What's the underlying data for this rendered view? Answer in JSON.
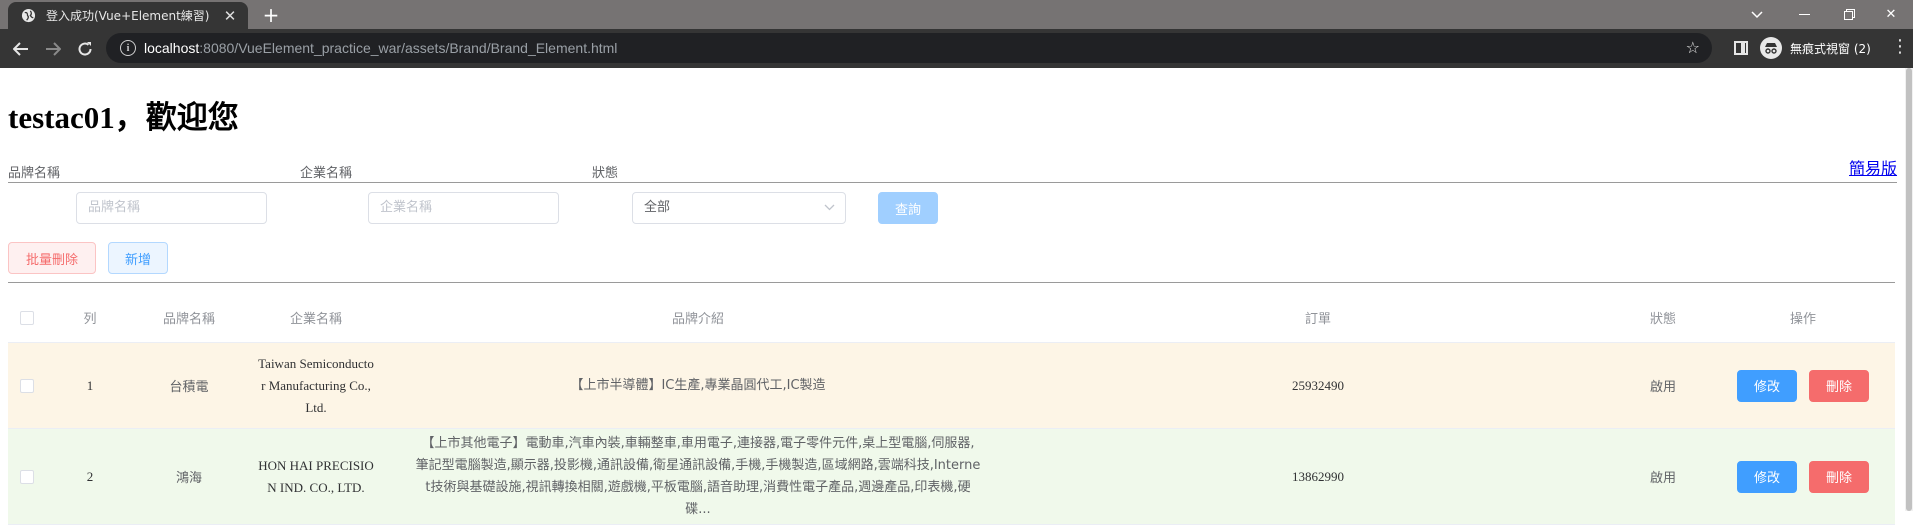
{
  "browser": {
    "tab_title": "登入成功(Vue+Element練習)",
    "url_host": "localhost",
    "url_rest": ":8080/VueElement_practice_war/assets/Brand/Brand_Element.html",
    "incognito_label": "無痕式視窗 (2)"
  },
  "page": {
    "welcome": "testac01，歡迎您",
    "simple_link": "簡易版"
  },
  "search": {
    "brand_label": "品牌名稱",
    "brand_placeholder": "品牌名稱",
    "company_label": "企業名稱",
    "company_placeholder": "企業名稱",
    "status_label": "狀態",
    "status_value": "全部",
    "query_button": "查詢"
  },
  "actions": {
    "batch_delete": "批量刪除",
    "add": "新增"
  },
  "table": {
    "headers": {
      "index": "列",
      "brand": "品牌名稱",
      "company": "企業名稱",
      "description": "品牌介紹",
      "order": "訂單",
      "status": "狀態",
      "operation": "操作"
    },
    "rows": [
      {
        "index": "1",
        "brand": "台積電",
        "company_lines": [
          "Taiwan Semiconducto",
          "r Manufacturing Co.,",
          "Ltd."
        ],
        "description_lines": [
          "【上市半導體】IC生產,專業晶圓代工,IC製造"
        ],
        "order": "25932490",
        "status": "啟用",
        "edit": "修改",
        "delete": "刪除"
      },
      {
        "index": "2",
        "brand": "鴻海",
        "company_lines": [
          "HON HAI PRECISIO",
          "N IND. CO., LTD."
        ],
        "description_lines": [
          "【上市其他電子】電動車,汽車內裝,車輛整車,車用電子,連接器,電子零件元件,桌上型電腦,伺服器,",
          "筆記型電腦製造,顯示器,投影機,通訊設備,衛星通訊設備,手機,手機製造,區域網路,雲端科技,Interne",
          "t技術與基礎設施,視訊轉換相關,遊戲機,平板電腦,語音助理,消費性電子產品,週邊產品,印表機,硬",
          "碟..."
        ],
        "order": "13862990",
        "status": "啟用",
        "edit": "修改",
        "delete": "刪除"
      }
    ]
  }
}
